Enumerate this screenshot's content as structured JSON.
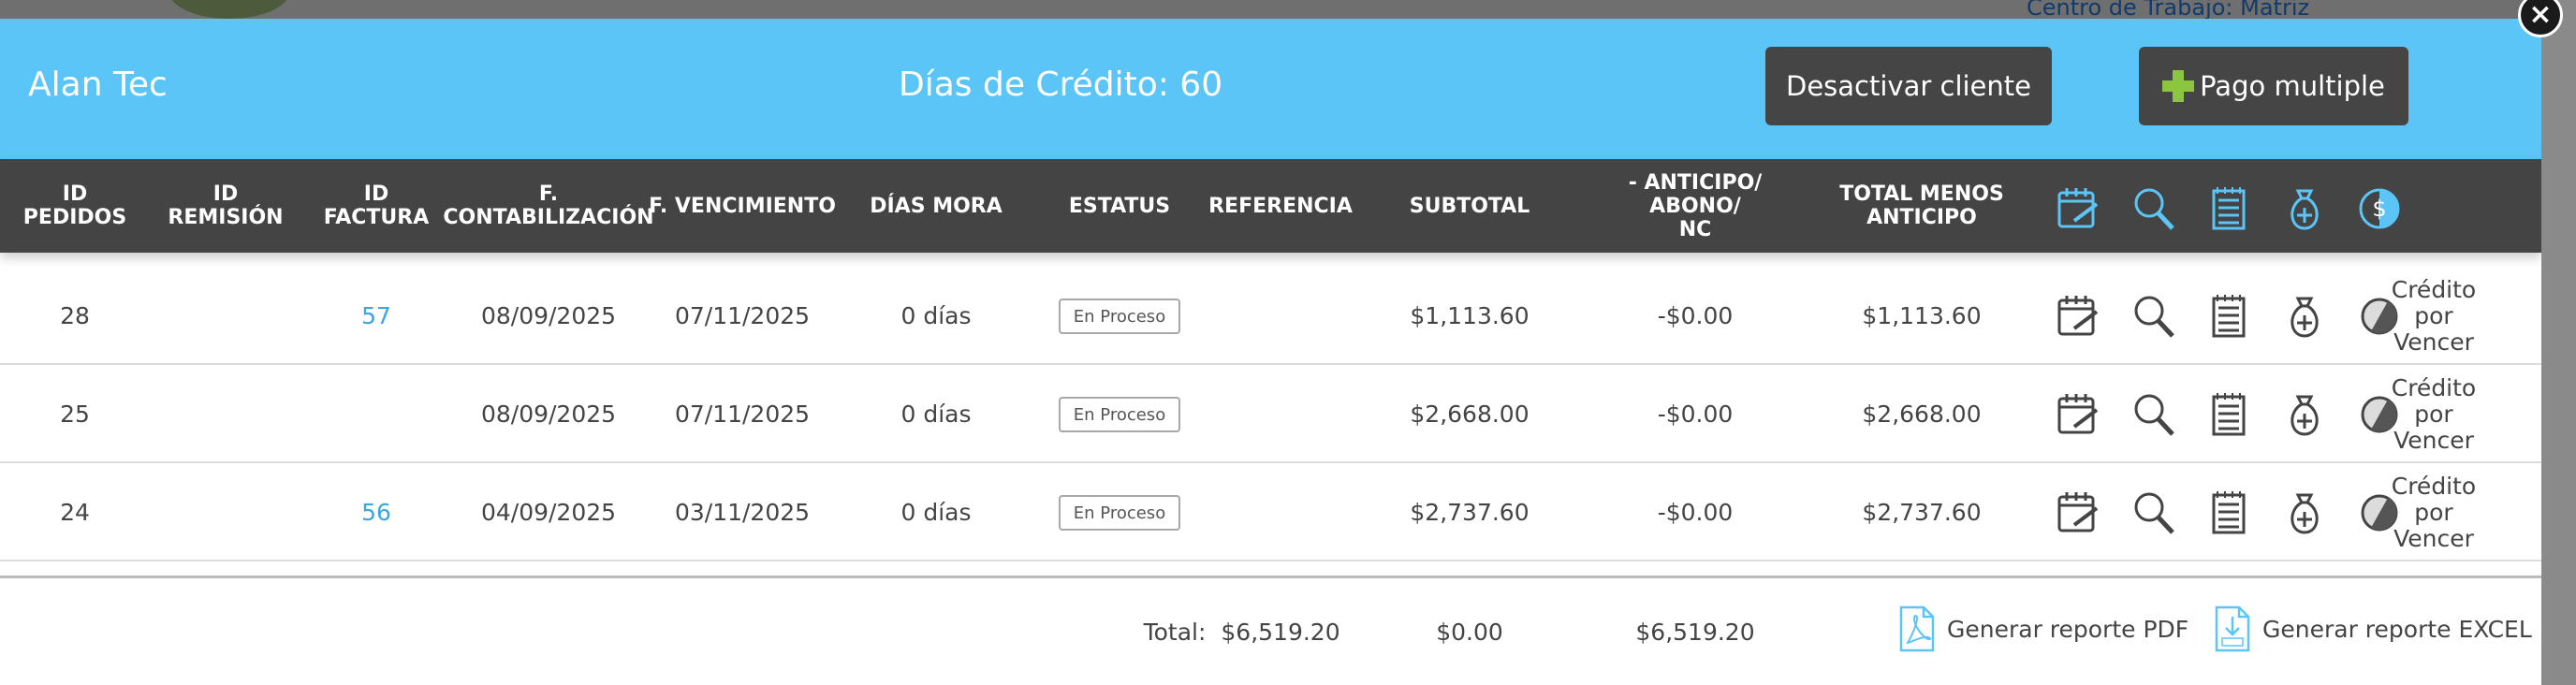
{
  "backdrop": {
    "workcenter_label": "Centro de Trabajo: Matriz"
  },
  "close_button": {
    "label": "×"
  },
  "header": {
    "client_name": "Alan Tec",
    "credit_days": "Días de Crédito: 60",
    "deactivate_label": "Desactivar cliente",
    "multipay_label": "Pago multiple",
    "bg_color": "#5bc5f7",
    "button_color": "#454545"
  },
  "columns": [
    "ID\nPEDIDOS",
    "ID\nREMISIÓN",
    "ID\nFACTURA",
    "F.\nCONTABILIZACIÓN",
    "F. VENCIMIENTO",
    "DÍAS MORA",
    "ESTATUS",
    "REFERENCIA",
    "SUBTOTAL",
    "- ANTICIPO/\nABONO/\nNC",
    "TOTAL MENOS\nANTICIPO"
  ],
  "header_icons": [
    "calendar-edit-icon",
    "search-icon",
    "notepad-icon",
    "money-bag-plus-icon",
    "dollar-circle-icon"
  ],
  "row_icons": [
    "calendar-edit-icon",
    "search-icon",
    "notepad-icon",
    "money-bag-plus-icon",
    "half-circle-icon"
  ],
  "rows": [
    {
      "pedido": "28",
      "remision": "",
      "factura": "57",
      "contabilizacion": "08/09/2025",
      "vencimiento": "07/11/2025",
      "mora": "0 días",
      "estatus": "En Proceso",
      "referencia": "",
      "subtotal": "$1,113.60",
      "anticipo": "-$0.00",
      "total": "$1,113.60",
      "status_text": "Crédito\npor\nVencer"
    },
    {
      "pedido": "25",
      "remision": "",
      "factura": "",
      "contabilizacion": "08/09/2025",
      "vencimiento": "07/11/2025",
      "mora": "0 días",
      "estatus": "En Proceso",
      "referencia": "",
      "subtotal": "$2,668.00",
      "anticipo": "-$0.00",
      "total": "$2,668.00",
      "status_text": "Crédito\npor\nVencer"
    },
    {
      "pedido": "24",
      "remision": "",
      "factura": "56",
      "contabilizacion": "04/09/2025",
      "vencimiento": "03/11/2025",
      "mora": "0 días",
      "estatus": "En Proceso",
      "referencia": "",
      "subtotal": "$2,737.60",
      "anticipo": "-$0.00",
      "total": "$2,737.60",
      "status_text": "Crédito\npor\nVencer"
    }
  ],
  "footer": {
    "total_label": "Total:",
    "subtotal": "$6,519.20",
    "anticipo": "$0.00",
    "total": "$6,519.20",
    "pdf_label": "Generar reporte PDF",
    "excel_label": "Generar reporte EXCEL"
  }
}
